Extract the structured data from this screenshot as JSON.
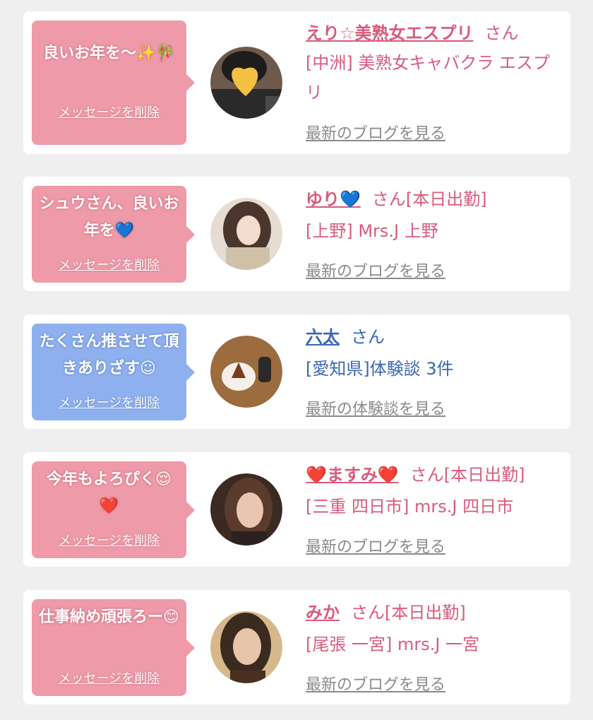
{
  "cards": [
    {
      "message": "良いお年を〜✨🎋",
      "delete_label": "メッセージを削除",
      "name": "えり☆美熟女エスプリ",
      "san": "さん",
      "status": "",
      "shop": "[中洲] 美熟女キャバクラ エスプリ",
      "latest": "最新のブログを見る",
      "bubble_color": "#ef9aa8"
    },
    {
      "message": "シュウさん、良いお年を💙",
      "delete_label": "メッセージを削除",
      "name": "ゆり💙",
      "san": "さん",
      "status": "[本日出勤]",
      "shop": "[上野] Mrs.J 上野",
      "latest": "最新のブログを見る",
      "bubble_color": "#ef9aa8"
    },
    {
      "message": "たくさん推させて頂きありざす☺",
      "delete_label": "メッセージを削除",
      "name": "六太",
      "san": "さん",
      "status": "",
      "shop": "[愛知県]体験談 3件",
      "latest": "最新の体験談を見る",
      "bubble_color": "#8fb0ee"
    },
    {
      "message": "今年もよろぴく😌❤️",
      "delete_label": "メッセージを削除",
      "name": "❤️ますみ❤️",
      "san": "さん",
      "status": "[本日出勤]",
      "shop": "[三重 四日市] mrs.J 四日市",
      "latest": "最新のブログを見る",
      "bubble_color": "#ef9aa8"
    },
    {
      "message": "仕事納め頑張ろー😊",
      "delete_label": "メッセージを削除",
      "name": "みか",
      "san": "さん",
      "status": "[本日出勤]",
      "shop": "[尾張 一宮] mrs.J 一宮",
      "latest": "最新のブログを見る",
      "bubble_color": "#ef9aa8"
    }
  ],
  "colors": {
    "card_bg": "#ffffff",
    "page_bg": "#efefef",
    "pink_bubble": "#ef9aa8",
    "blue_bubble": "#8fb0ee",
    "pink_text": "#d95b7d",
    "blue_text": "#3a66b5",
    "link_gray": "#8a8a8a"
  },
  "icons": {
    "avatar": "avatar-photo"
  }
}
